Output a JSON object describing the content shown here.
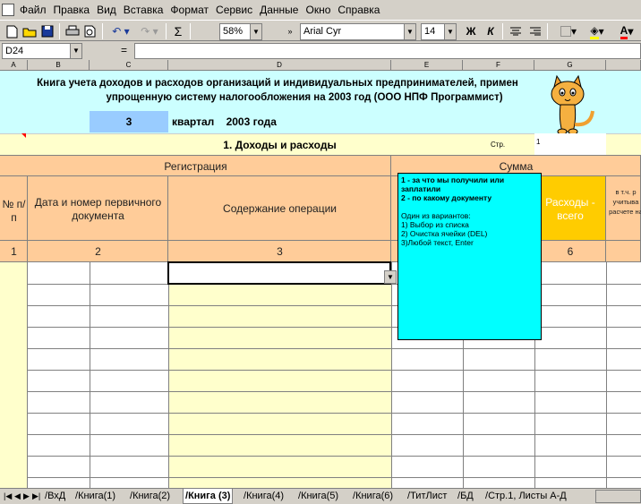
{
  "menu": [
    "Файл",
    "Правка",
    "Вид",
    "Вставка",
    "Формат",
    "Сервис",
    "Данные",
    "Окно",
    "Справка"
  ],
  "toolbar": {
    "zoom": "58%",
    "font": "Arial Cyr",
    "size": "14",
    "bold": "Ж",
    "italic": "К",
    "sigma": "Σ"
  },
  "formula": {
    "cellref": "D24",
    "equals": "="
  },
  "columns": [
    "A",
    "B",
    "C",
    "D",
    "E",
    "F",
    "G"
  ],
  "title": {
    "line1": "Книга учета доходов и расходов организаций  и индивидуальных предпринимателей,       примен",
    "line2": "упрощенную систему налогообложения на 2003 год (ООО НПФ Программист)"
  },
  "quarter": {
    "num": "3",
    "label": "квартал    2003 года"
  },
  "section": {
    "title": "1. Доходы и расходы",
    "page_label": "Стр.",
    "page_num": "1"
  },
  "table": {
    "registration": "Регистрация",
    "sum": "Сумма",
    "col_num": "№ п/п",
    "col_date": "Дата  и номер первичного документа",
    "col_content": "Содержание операции",
    "col_expense": "Расходы - всего",
    "col_incl": "в т.ч. р учитыва расчете на",
    "nums": [
      "1",
      "2",
      "3",
      "6"
    ]
  },
  "tooltip": {
    "l1": "1 - за что мы получили или заплатили",
    "l2": "2 - по какому документу",
    "l3": "Один из вариантов:",
    "l4": "1) Выбор из списка",
    "l5": "2) Очистка ячейки (DEL)",
    "l6": "3)Любой текст, Enter"
  },
  "tabs": [
    "ВхД",
    "Книга(1)",
    "Книга(2)",
    "Книга (3)",
    "Книга(4)",
    "Книга(5)",
    "Книга(6)",
    "ТитЛист",
    "БД",
    "Стр.1, Листы А-Д"
  ]
}
